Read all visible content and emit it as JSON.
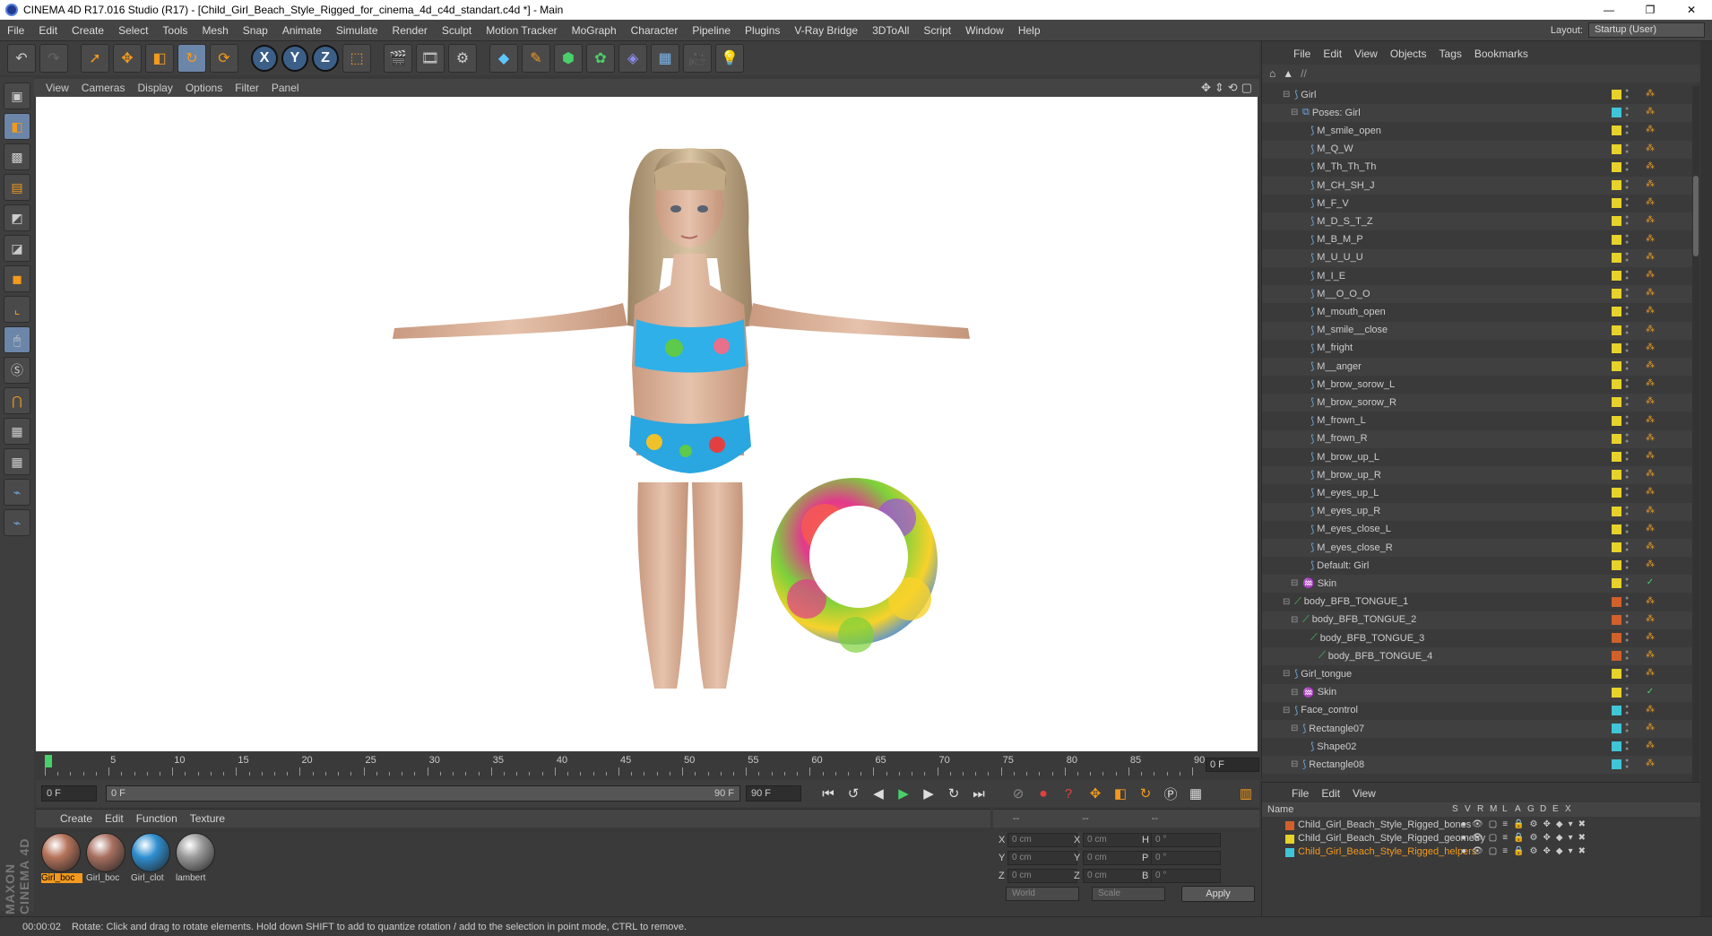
{
  "window": {
    "title": "CINEMA 4D R17.016 Studio (R17) - [Child_Girl_Beach_Style_Rigged_for_cinema_4d_c4d_standart.c4d *] - Main",
    "min": "—",
    "restore": "❐",
    "close": "✕"
  },
  "menu": [
    "File",
    "Edit",
    "Create",
    "Select",
    "Tools",
    "Mesh",
    "Snap",
    "Animate",
    "Simulate",
    "Render",
    "Sculpt",
    "Motion Tracker",
    "MoGraph",
    "Character",
    "Pipeline",
    "Plugins",
    "V-Ray Bridge",
    "3DToAll",
    "Script",
    "Window",
    "Help"
  ],
  "layout": {
    "label": "Layout:",
    "value": "Startup (User)"
  },
  "viewport": {
    "menu": [
      "View",
      "Cameras",
      "Display",
      "Options",
      "Filter",
      "Panel"
    ]
  },
  "timeline": {
    "labels": [
      "0",
      "5",
      "10",
      "15",
      "20",
      "25",
      "30",
      "35",
      "40",
      "45",
      "50",
      "55",
      "60",
      "65",
      "70",
      "75",
      "80",
      "85",
      "90"
    ],
    "end_frame": "0 F"
  },
  "playback": {
    "start": "0 F",
    "range_start": "0 F",
    "range_end": "90 F",
    "end": "90 F"
  },
  "materials": {
    "menu": [
      "Create",
      "Edit",
      "Function",
      "Texture"
    ],
    "items": [
      {
        "label": "Girl_boc",
        "color": "#b5735a",
        "active": true
      },
      {
        "label": "Girl_boc",
        "color": "#a87060",
        "active": false
      },
      {
        "label": "Girl_clot",
        "color": "#2f8fd0",
        "active": false
      },
      {
        "label": "lambert",
        "color": "#9a9a9a",
        "active": false
      }
    ]
  },
  "coords": {
    "head": [
      "--",
      "--",
      "--"
    ],
    "rows": [
      {
        "a": "X",
        "av": "0 cm",
        "b": "X",
        "bv": "0 cm",
        "c": "H",
        "cv": "0 °"
      },
      {
        "a": "Y",
        "av": "0 cm",
        "b": "Y",
        "bv": "0 cm",
        "c": "P",
        "cv": "0 °"
      },
      {
        "a": "Z",
        "av": "0 cm",
        "b": "Z",
        "bv": "0 cm",
        "c": "B",
        "cv": "0 °"
      }
    ],
    "world": "World",
    "scale": "Scale",
    "apply": "Apply"
  },
  "status": {
    "time": "00:00:02",
    "text": "Rotate: Click and drag to rotate elements. Hold down SHIFT to add to quantize rotation / add to the selection in point mode, CTRL to remove."
  },
  "objects": {
    "menu": [
      "File",
      "Edit",
      "View",
      "Objects",
      "Tags",
      "Bookmarks"
    ],
    "path": "//",
    "rows": [
      {
        "name": "Girl",
        "indent": 1,
        "icon": "joint",
        "layer": "#e6d22a"
      },
      {
        "name": "Poses: Girl",
        "indent": 2,
        "icon": "pose",
        "layer": "#3fc6d6"
      },
      {
        "name": "M_smile_open",
        "indent": 3,
        "icon": "joint",
        "layer": "#e6d22a"
      },
      {
        "name": "M_Q_W",
        "indent": 3,
        "icon": "joint",
        "layer": "#e6d22a"
      },
      {
        "name": "M_Th_Th_Th",
        "indent": 3,
        "icon": "joint",
        "layer": "#e6d22a"
      },
      {
        "name": "M_CH_SH_J",
        "indent": 3,
        "icon": "joint",
        "layer": "#e6d22a"
      },
      {
        "name": "M_F_V",
        "indent": 3,
        "icon": "joint",
        "layer": "#e6d22a"
      },
      {
        "name": "M_D_S_T_Z",
        "indent": 3,
        "icon": "joint",
        "layer": "#e6d22a"
      },
      {
        "name": "M_B_M_P",
        "indent": 3,
        "icon": "joint",
        "layer": "#e6d22a"
      },
      {
        "name": "M_U_U_U",
        "indent": 3,
        "icon": "joint",
        "layer": "#e6d22a"
      },
      {
        "name": "M_I_E",
        "indent": 3,
        "icon": "joint",
        "layer": "#e6d22a"
      },
      {
        "name": "M__O_O_O",
        "indent": 3,
        "icon": "joint",
        "layer": "#e6d22a"
      },
      {
        "name": "M_mouth_open",
        "indent": 3,
        "icon": "joint",
        "layer": "#e6d22a"
      },
      {
        "name": "M_smile__close",
        "indent": 3,
        "icon": "joint",
        "layer": "#e6d22a"
      },
      {
        "name": "M_fright",
        "indent": 3,
        "icon": "joint",
        "layer": "#e6d22a"
      },
      {
        "name": "M__anger",
        "indent": 3,
        "icon": "joint",
        "layer": "#e6d22a"
      },
      {
        "name": "M_brow_sorow_L",
        "indent": 3,
        "icon": "joint",
        "layer": "#e6d22a"
      },
      {
        "name": "M_brow_sorow_R",
        "indent": 3,
        "icon": "joint",
        "layer": "#e6d22a"
      },
      {
        "name": "M_frown_L",
        "indent": 3,
        "icon": "joint",
        "layer": "#e6d22a"
      },
      {
        "name": "M_frown_R",
        "indent": 3,
        "icon": "joint",
        "layer": "#e6d22a"
      },
      {
        "name": "M_brow_up_L",
        "indent": 3,
        "icon": "joint",
        "layer": "#e6d22a"
      },
      {
        "name": "M_brow_up_R",
        "indent": 3,
        "icon": "joint",
        "layer": "#e6d22a"
      },
      {
        "name": "M_eyes_up_L",
        "indent": 3,
        "icon": "joint",
        "layer": "#e6d22a"
      },
      {
        "name": "M_eyes_up_R",
        "indent": 3,
        "icon": "joint",
        "layer": "#e6d22a"
      },
      {
        "name": "M_eyes_close_L",
        "indent": 3,
        "icon": "joint",
        "layer": "#e6d22a"
      },
      {
        "name": "M_eyes_close_R",
        "indent": 3,
        "icon": "joint",
        "layer": "#e6d22a"
      },
      {
        "name": "Default: Girl",
        "indent": 3,
        "icon": "joint",
        "layer": "#e6d22a"
      },
      {
        "name": "Skin",
        "indent": 2,
        "icon": "skin",
        "layer": "#e6d22a"
      },
      {
        "name": "body_BFB_TONGUE_1",
        "indent": 1,
        "icon": "bone",
        "layer": "#d2602a"
      },
      {
        "name": "body_BFB_TONGUE_2",
        "indent": 2,
        "icon": "bone",
        "layer": "#d2602a"
      },
      {
        "name": "body_BFB_TONGUE_3",
        "indent": 3,
        "icon": "bone",
        "layer": "#d2602a"
      },
      {
        "name": "body_BFB_TONGUE_4",
        "indent": 4,
        "icon": "bone",
        "layer": "#d2602a"
      },
      {
        "name": "Girl_tongue",
        "indent": 1,
        "icon": "joint",
        "layer": "#e6d22a"
      },
      {
        "name": "Skin",
        "indent": 2,
        "icon": "skin",
        "layer": "#e6d22a"
      },
      {
        "name": "Face_control",
        "indent": 1,
        "icon": "joint",
        "layer": "#3fc6d6"
      },
      {
        "name": "Rectangle07",
        "indent": 2,
        "icon": "joint",
        "layer": "#3fc6d6"
      },
      {
        "name": "Shape02",
        "indent": 3,
        "icon": "joint",
        "layer": "#3fc6d6"
      },
      {
        "name": "Rectangle08",
        "indent": 2,
        "icon": "joint",
        "layer": "#3fc6d6"
      }
    ]
  },
  "layers": {
    "menu": [
      "File",
      "Edit",
      "View"
    ],
    "name_header": "Name",
    "cols": [
      "S",
      "V",
      "R",
      "M",
      "L",
      "A",
      "G",
      "D",
      "E",
      "X"
    ],
    "rows": [
      {
        "name": "Child_Girl_Beach_Style_Rigged_bones",
        "color": "#d2602a",
        "hl": false
      },
      {
        "name": "Child_Girl_Beach_Style_Rigged_geometry",
        "color": "#e6d22a",
        "hl": false
      },
      {
        "name": "Child_Girl_Beach_Style_Rigged_helpers",
        "color": "#3fc6d6",
        "hl": true
      }
    ]
  },
  "brand": "MAXON CINEMA 4D"
}
